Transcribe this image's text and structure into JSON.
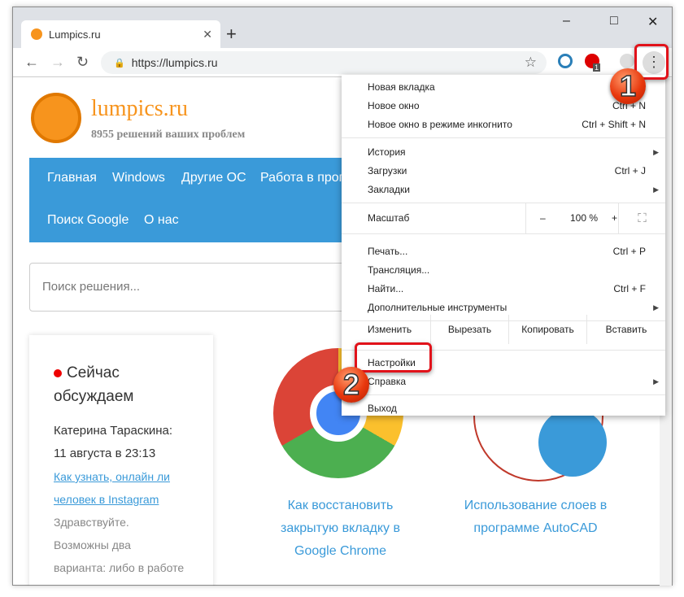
{
  "browser": {
    "tab_title": "Lumpics.ru",
    "url": "https://lumpics.ru",
    "new_tab": "+",
    "minimize": "–",
    "maximize": "□",
    "close": "✕",
    "extension_badge": "1",
    "menu_icon": "⋮"
  },
  "page": {
    "brand": "lumpics.ru",
    "slogan": "8955 решений ваших проблем",
    "nav": [
      "Главная",
      "Windows",
      "Другие ОС",
      "Работа в прог",
      "Поиск Google",
      "О нас"
    ],
    "search_placeholder": "Поиск решения...",
    "sidebar": {
      "title1": "Сейчас",
      "title2": "обсуждаем",
      "author": "Катерина Тараскина:",
      "date": "11 августа в 23:13",
      "link1": "Как узнать, онлайн ли",
      "link2": "человек в Instagram",
      "text1": "Здравствуйте.",
      "text2": "Возможны два",
      "text3": "варианта: либо в работе"
    },
    "cards": [
      {
        "l1": "Как восстановить",
        "l2": "закрытую вкладку в",
        "l3": "Google Chrome"
      },
      {
        "l1": "Использование слоев в",
        "l2": "программе AutoCAD"
      }
    ]
  },
  "menu": {
    "new_tab": "Новая вкладка",
    "new_window": "Новое окно",
    "new_window_sc": "Ctrl + N",
    "incognito": "Новое окно в режиме инкогнито",
    "incognito_sc": "Ctrl + Shift + N",
    "history": "История",
    "downloads": "Загрузки",
    "downloads_sc": "Ctrl + J",
    "bookmarks": "Закладки",
    "zoom_label": "Масштаб",
    "zoom_minus": "–",
    "zoom_value": "100 %",
    "zoom_plus": "+",
    "print": "Печать...",
    "print_sc": "Ctrl + P",
    "cast": "Трансляция...",
    "find": "Найти...",
    "find_sc": "Ctrl + F",
    "more_tools": "Дополнительные инструменты",
    "edit": "Изменить",
    "cut": "Вырезать",
    "copy": "Копировать",
    "paste": "Вставить",
    "settings": "Настройки",
    "help": "Справка",
    "exit": "Выход"
  },
  "annotations": {
    "step1": "1",
    "step2": "2"
  },
  "colors": {
    "accent": "#3a9ad9",
    "brand": "#f7941d",
    "highlight": "#e1121a"
  }
}
